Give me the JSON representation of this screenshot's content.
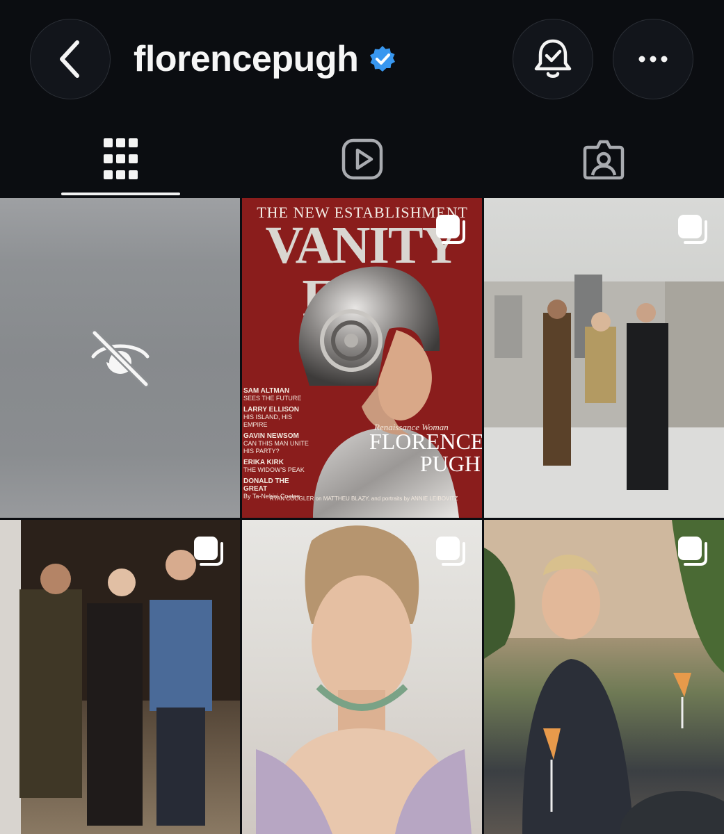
{
  "header": {
    "username": "florencepugh",
    "verified_icon": "verified-badge-icon",
    "back_icon": "chevron-left-icon",
    "bell_icon": "notification-bell-icon",
    "more_icon": "more-horizontal-icon"
  },
  "tabs": [
    {
      "icon": "grid-icon",
      "selected": true
    },
    {
      "icon": "reels-icon",
      "selected": false
    },
    {
      "icon": "tagged-icon",
      "selected": false
    }
  ],
  "posts": [
    {
      "type": "hidden",
      "icon": "eye-off-icon"
    },
    {
      "type": "magazine-cover",
      "multi": true,
      "cover": {
        "top_line": "THE NEW ESTABLISHMENT",
        "masthead": "VANITY FAIR",
        "subtitle": "Renaissance Woman",
        "name_line1": "FLORENCE",
        "name_line2": "PUGH",
        "lines": [
          {
            "head": "SAM ALTMAN",
            "sub": "SEES THE FUTURE"
          },
          {
            "head": "LARRY ELLISON",
            "sub": "HIS ISLAND, HIS EMPIRE"
          },
          {
            "head": "GAVIN NEWSOM",
            "sub": "CAN THIS MAN UNITE HIS PARTY?"
          },
          {
            "head": "ERIKA KIRK",
            "sub": "THE WIDOW'S PEAK"
          },
          {
            "head": "DONALD THE GREAT",
            "sub": "By Ta-Nehisi Coates"
          }
        ],
        "footer": "RYAN COOGLER on MATTHEU BLAZY, and portraits by ANNIE LEIBOVITZ"
      }
    },
    {
      "type": "photo",
      "multi": true
    },
    {
      "type": "photo",
      "multi": true
    },
    {
      "type": "photo",
      "multi": true
    },
    {
      "type": "photo",
      "multi": true
    }
  ],
  "colors": {
    "background": "#0b0d11",
    "verified": "#3897f0",
    "cover_red": "#8a1d1c"
  }
}
